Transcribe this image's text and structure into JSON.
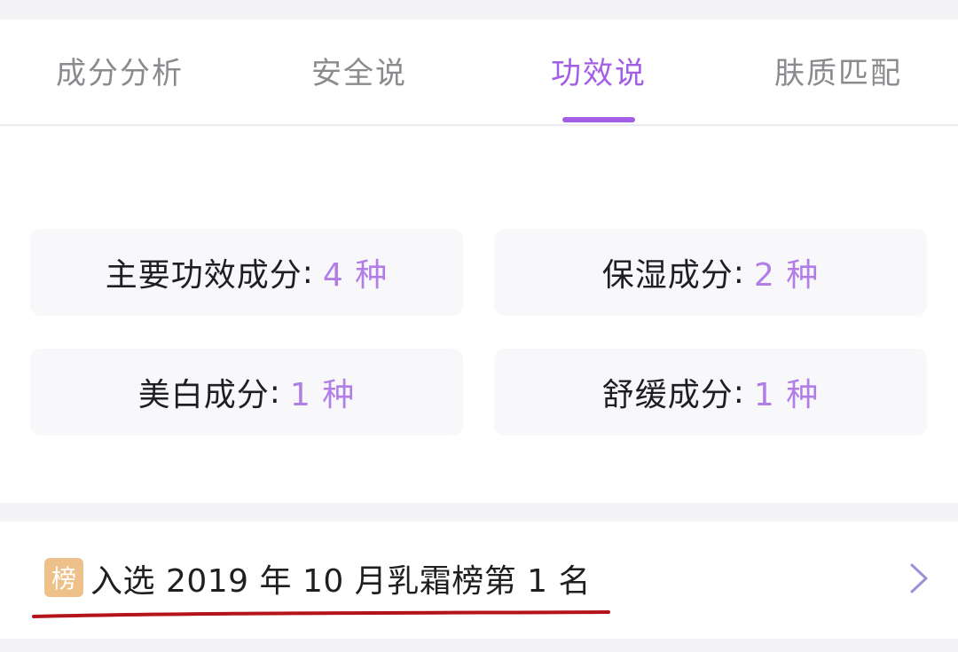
{
  "tabs": [
    {
      "label": "成分分析",
      "active": false
    },
    {
      "label": "安全说",
      "active": false
    },
    {
      "label": "功效说",
      "active": true
    },
    {
      "label": "肤质匹配",
      "active": false
    }
  ],
  "stats": [
    {
      "label": "主要功效成分",
      "separator": ":",
      "value": "4 种"
    },
    {
      "label": "保湿成分",
      "separator": ":",
      "value": "2 种"
    },
    {
      "label": "美白成分",
      "separator": ":",
      "value": "1 种"
    },
    {
      "label": "舒缓成分",
      "separator": ":",
      "value": "1 种"
    }
  ],
  "ranking": {
    "badge": "榜",
    "text": "入选 2019 年 10 月乳霜榜第 1 名",
    "icon": "chevron-right-icon"
  },
  "colors": {
    "accent": "#a35ee6",
    "value": "#b07ee6",
    "badge_bg": "#eec08a",
    "underline_mark": "#b3131a"
  }
}
